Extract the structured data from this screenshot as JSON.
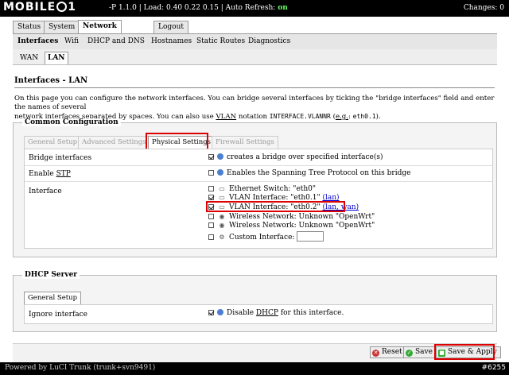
{
  "topbar": {
    "logo_text_left": "MOBILE",
    "logo_text_right": "1",
    "status_text": "-P 1.1.0 | Load: 0.40 0.22 0.15 | Auto Refresh: ",
    "auto_refresh_value": "on",
    "changes": "Changes: 0"
  },
  "main_tabs": [
    "Status",
    "System",
    "Network",
    "Logout"
  ],
  "sub_tabs": [
    "Interfaces",
    "Wifi",
    "DHCP and DNS",
    "Hostnames",
    "Static Routes",
    "Diagnostics"
  ],
  "iface_tabs": [
    "WAN",
    "LAN"
  ],
  "page": {
    "title": "Interfaces - LAN",
    "desc_1": "On this page you can configure the network interfaces. You can bridge several interfaces by ticking the \"bridge interfaces\" field and enter the names of several",
    "desc_2a": "network interfaces separated by spaces. You can also use ",
    "desc_vlan": "VLAN",
    "desc_2b": " notation ",
    "desc_mono1": "INTERFACE.VLANNR",
    "desc_2c": " (",
    "desc_eg": "e.g.",
    "desc_2d": ": ",
    "desc_mono2": "eth0.1",
    "desc_2e": ")."
  },
  "common": {
    "legend": "Common Configuration",
    "tabs": [
      "General Setup",
      "Advanced Settings",
      "Physical Settings",
      "Firewall Settings"
    ],
    "bridge_label": "Bridge interfaces",
    "bridge_text": "creates a bridge over specified interface(s)",
    "stp_label_a": "Enable ",
    "stp_label_b": "STP",
    "stp_text": "Enables the Spanning Tree Protocol on this bridge",
    "interface_label": "Interface",
    "interfaces": [
      {
        "text": "Ethernet Switch: \"eth0\"",
        "extra": "",
        "checked": false,
        "icon": "switch-icon"
      },
      {
        "text": "VLAN Interface: \"eth0.1\" ",
        "extra": "(lan)",
        "checked": true,
        "icon": "vlan-icon"
      },
      {
        "text": "VLAN Interface: \"eth0.2\" ",
        "extra": "(lan, wan)",
        "checked": true,
        "icon": "vlan-icon"
      },
      {
        "text": "Wireless Network: Unknown \"OpenWrt\"",
        "extra": "",
        "checked": false,
        "icon": "wifi-icon"
      },
      {
        "text": "Wireless Network: Unknown \"OpenWrt\"",
        "extra": "",
        "checked": false,
        "icon": "wifi-icon"
      }
    ],
    "custom_label": "Custom Interface:"
  },
  "dhcp": {
    "legend": "DHCP Server",
    "tab": "General Setup",
    "ignore_label": "Ignore interface",
    "ignore_text_a": "Disable ",
    "ignore_text_b": "DHCP",
    "ignore_text_c": " for this interface."
  },
  "buttons": {
    "reset": "Reset",
    "save": "Save",
    "apply": "Save & Apply"
  },
  "footer": {
    "powered": "Powered by LuCI Trunk (trunk+svn9491)",
    "watermark": "#6255"
  },
  "colors": {
    "highlight_red": "#dd0000",
    "link_blue": "#0000cc",
    "help_blue": "#4d7fd0"
  }
}
